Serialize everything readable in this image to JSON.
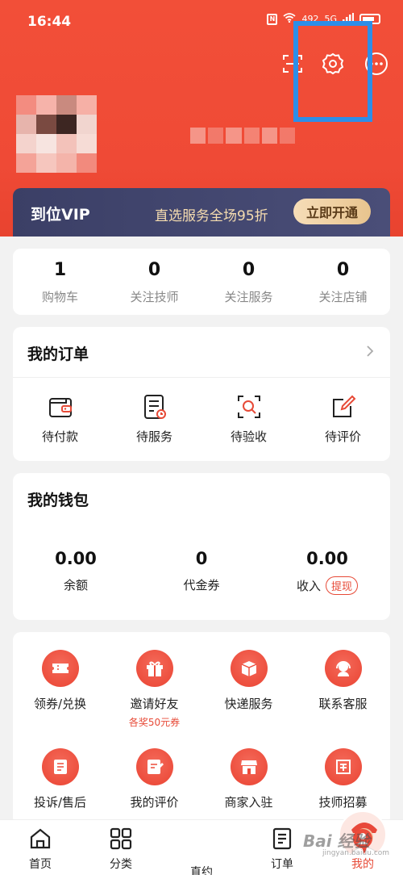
{
  "status_bar": {
    "time": "16:44",
    "network_speed": "492",
    "signal": "5G"
  },
  "header": {
    "icons": [
      "scan-icon",
      "gear-icon",
      "more-icon"
    ],
    "highlight_color": "#2d8ee8"
  },
  "vip": {
    "title": "到位VIP",
    "description": "直选服务全场95折",
    "button_label": "立即开通"
  },
  "stats": [
    {
      "value": "1",
      "label": "购物车"
    },
    {
      "value": "0",
      "label": "关注技师"
    },
    {
      "value": "0",
      "label": "关注服务"
    },
    {
      "value": "0",
      "label": "关注店铺"
    }
  ],
  "orders": {
    "title": "我的订单",
    "items": [
      {
        "label": "待付款",
        "icon": "wallet-icon"
      },
      {
        "label": "待服务",
        "icon": "service-list-icon"
      },
      {
        "label": "待验收",
        "icon": "inspect-icon"
      },
      {
        "label": "待评价",
        "icon": "review-pen-icon"
      }
    ]
  },
  "wallet": {
    "title": "我的钱包",
    "items": [
      {
        "value": "0.00",
        "label": "余额"
      },
      {
        "value": "0",
        "label": "代金券"
      },
      {
        "value": "0.00",
        "label": "收入",
        "badge": "提现"
      }
    ]
  },
  "services": [
    {
      "label": "领券/兑换",
      "icon": "coupon-icon"
    },
    {
      "label": "邀请好友",
      "sub": "各奖50元券",
      "icon": "gift-icon"
    },
    {
      "label": "快递服务",
      "icon": "package-icon"
    },
    {
      "label": "联系客服",
      "icon": "headset-icon"
    },
    {
      "label": "投诉/售后",
      "icon": "complaint-icon"
    },
    {
      "label": "我的评价",
      "icon": "review-icon"
    },
    {
      "label": "商家入驻",
      "icon": "store-icon"
    },
    {
      "label": "技师招募",
      "icon": "recruit-icon"
    }
  ],
  "tabbar": [
    {
      "label": "首页",
      "icon": "home-icon"
    },
    {
      "label": "分类",
      "icon": "category-icon"
    },
    {
      "label": "直约",
      "icon": "avatar-icon"
    },
    {
      "label": "订单",
      "icon": "order-icon"
    },
    {
      "label": "我的",
      "icon": "profile-icon",
      "active": true
    }
  ],
  "watermark": {
    "text": "Bai 经验",
    "sub": "jingyan.baidu.com"
  },
  "colors": {
    "brand_red": "#ef4a36",
    "vip_bg": "#3b3f66",
    "vip_gold": "#f6ddb0"
  }
}
